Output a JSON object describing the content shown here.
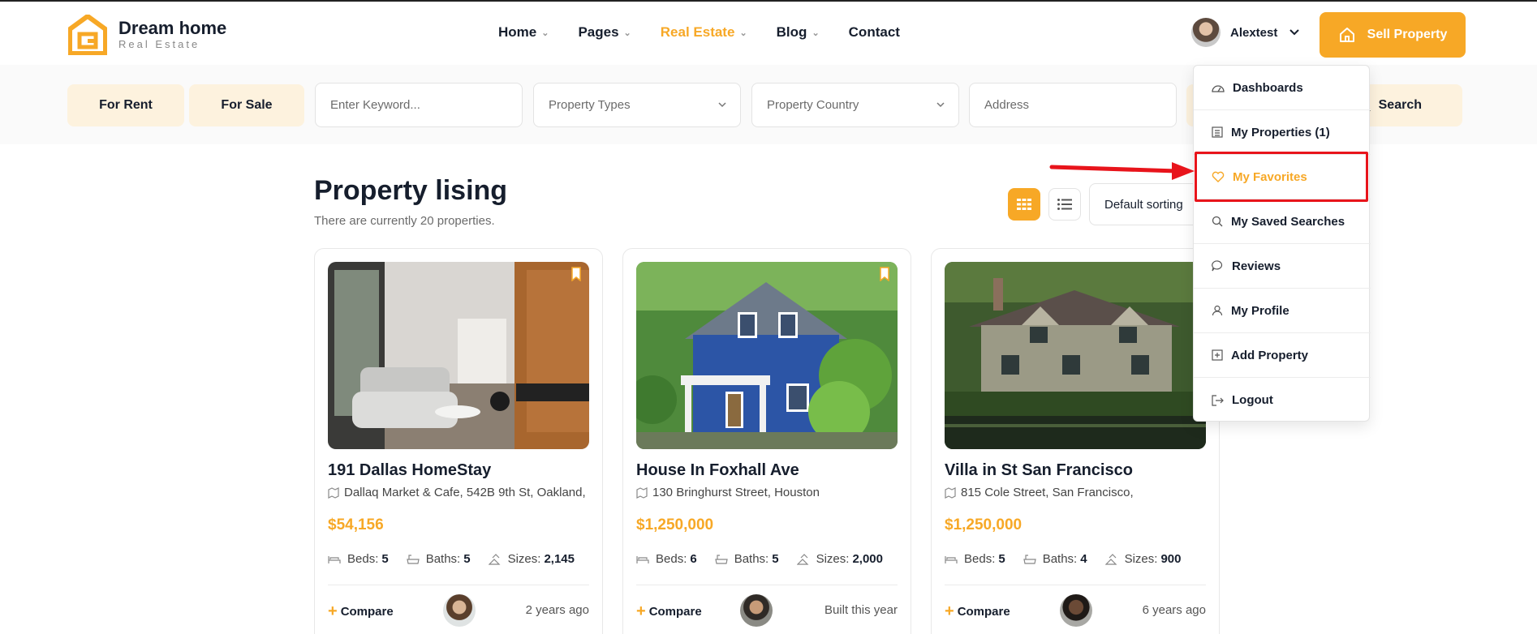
{
  "brand": {
    "name": "Dream home",
    "tagline": "Real Estate"
  },
  "nav": {
    "items": [
      {
        "label": "Home",
        "has_caret": true,
        "active": false
      },
      {
        "label": "Pages",
        "has_caret": true,
        "active": false
      },
      {
        "label": "Real Estate",
        "has_caret": true,
        "active": true
      },
      {
        "label": "Blog",
        "has_caret": true,
        "active": false
      },
      {
        "label": "Contact",
        "has_caret": false,
        "active": false
      }
    ]
  },
  "user": {
    "name": "Alextest",
    "avatar_icon": "user-avatar"
  },
  "sell_button": {
    "label": "Sell Property",
    "icon": "house-icon"
  },
  "search": {
    "tabs": [
      {
        "label": "For Rent"
      },
      {
        "label": "For Sale"
      }
    ],
    "keyword_placeholder": "Enter Keyword...",
    "property_types": "Property Types",
    "property_country": "Property Country",
    "address_placeholder": "Address",
    "button_label": "Search"
  },
  "listing": {
    "title": "Property lising",
    "subtitle": "There are currently 20 properties.",
    "sort_label": "Default sorting",
    "view_mode": "grid"
  },
  "cards": [
    {
      "title": "191 Dallas HomeStay",
      "address": "Dallaq Market & Cafe, 542B 9th St, Oakland,",
      "price": "$54,156",
      "beds_label": "Beds:",
      "beds": "5",
      "baths_label": "Baths:",
      "baths": "5",
      "sizes_label": "Sizes:",
      "sizes": "2,145",
      "compare_label": "Compare",
      "age": "2 years ago"
    },
    {
      "title": "House In Foxhall Ave",
      "address": "130 Bringhurst Street, Houston",
      "price": "$1,250,000",
      "beds_label": "Beds:",
      "beds": "6",
      "baths_label": "Baths:",
      "baths": "5",
      "sizes_label": "Sizes:",
      "sizes": "2,000",
      "compare_label": "Compare",
      "age": "Built this year"
    },
    {
      "title": "Villa in St San Francisco",
      "address": "815 Cole Street, San Francisco,",
      "price": "$1,250,000",
      "beds_label": "Beds:",
      "beds": "5",
      "baths_label": "Baths:",
      "baths": "4",
      "sizes_label": "Sizes:",
      "sizes": "900",
      "compare_label": "Compare",
      "age": "6 years ago"
    }
  ],
  "user_menu": {
    "items": [
      {
        "label": "Dashboards",
        "icon": "dashboard-icon"
      },
      {
        "label": "My Properties (1)",
        "icon": "list-icon"
      },
      {
        "label": "My Favorites",
        "icon": "heart-icon",
        "active": true
      },
      {
        "label": "My Saved Searches",
        "icon": "search-icon"
      },
      {
        "label": "Reviews",
        "icon": "chat-icon"
      },
      {
        "label": "My Profile",
        "icon": "user-icon"
      },
      {
        "label": "Add Property",
        "icon": "plus-square-icon"
      },
      {
        "label": "Logout",
        "icon": "logout-icon"
      }
    ]
  },
  "colors": {
    "accent": "#f7a826",
    "accent_soft": "#fdf2de",
    "text": "#161e2d",
    "annotation": "#e8141b"
  }
}
